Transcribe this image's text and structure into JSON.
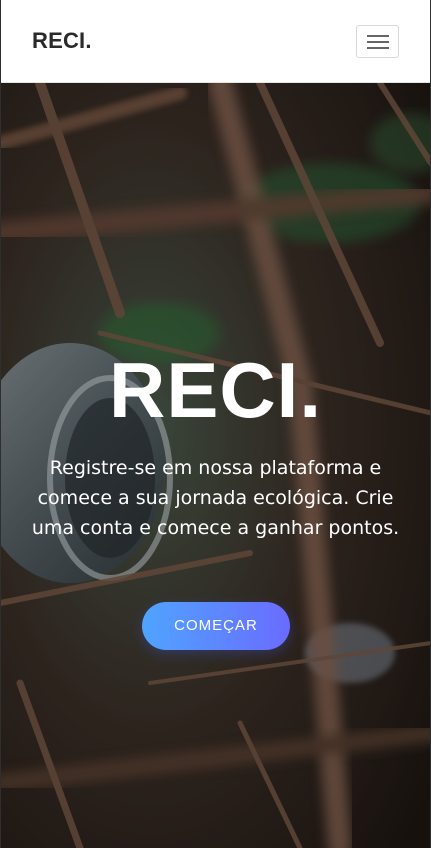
{
  "navbar": {
    "brand": "RECI.",
    "menu_icon": "hamburger-menu-icon"
  },
  "hero": {
    "title": "RECI.",
    "description": "Registre-se em nossa plataforma e comece a sua jornada ecológica. Crie uma conta e comece a ganhar pontos.",
    "cta_label": "COMEÇAR",
    "background_image": "discarded can among twigs and leaves"
  },
  "colors": {
    "navbar_bg": "#ffffff",
    "brand_text": "#2a2a2a",
    "hero_text": "#ffffff",
    "cta_gradient_start": "#4fa4ff",
    "cta_gradient_end": "#6a6bff"
  }
}
